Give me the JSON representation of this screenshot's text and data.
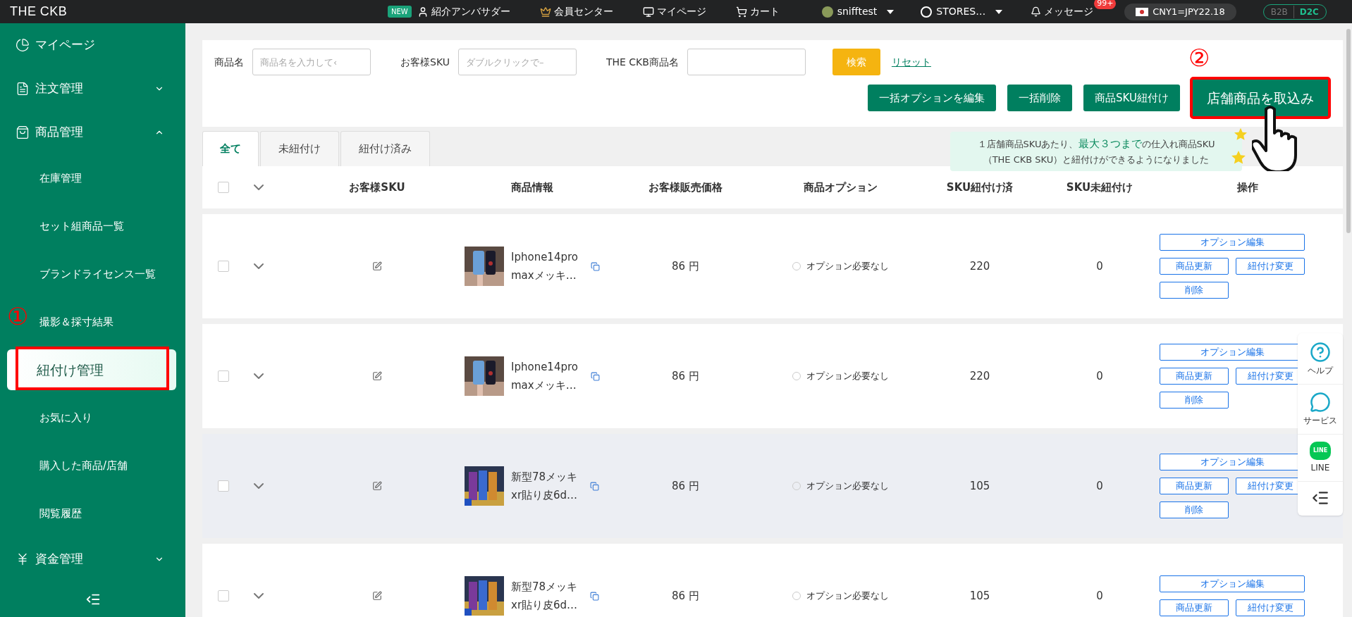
{
  "topbar": {
    "logo": "THE CKB",
    "nav": [
      {
        "kind": "ambassador",
        "badge": "NEW",
        "label": "紹介アンバサダー"
      },
      {
        "kind": "member",
        "label": "会員センター"
      },
      {
        "kind": "mypage",
        "label": "マイページ"
      },
      {
        "kind": "cart",
        "label": "カート"
      }
    ],
    "user": "snifftest",
    "store": "STORES…",
    "messages": {
      "label": "メッセージ",
      "badge": "99+"
    },
    "currency": "CNY1=JPY22.18",
    "modes": [
      {
        "label": "B2B",
        "selected": false
      },
      {
        "label": "D2C",
        "selected": true
      }
    ]
  },
  "sidebar": {
    "items": [
      {
        "kind": "pie",
        "label": "マイページ"
      },
      {
        "kind": "order",
        "label": "注文管理",
        "expanded": false
      },
      {
        "kind": "bag",
        "label": "商品管理",
        "expanded": true,
        "children": [
          {
            "label": "在庫管理",
            "selected": false
          },
          {
            "label": "セット組商品一覧",
            "selected": false
          },
          {
            "label": "ブランドライセンス一覧",
            "selected": false
          },
          {
            "label": "撮影＆採寸結果",
            "selected": false
          },
          {
            "label": "紐付け管理",
            "selected": true
          },
          {
            "label": "お気に入り",
            "selected": false
          },
          {
            "label": "購入した商品/店舗",
            "selected": false
          },
          {
            "label": "閲覧履歴",
            "selected": false
          }
        ]
      },
      {
        "kind": "yen",
        "label": "資金管理",
        "expanded": false
      }
    ]
  },
  "markers": [
    "①",
    "②"
  ],
  "filters": {
    "fields": [
      {
        "label": "商品名",
        "placeholder": "商品名を入力して‹"
      },
      {
        "label": "お客様SKU",
        "placeholder": "ダブルクリックで–"
      },
      {
        "label": "THE CKB商品名"
      }
    ],
    "search": "検索",
    "reset": "リセット"
  },
  "actions": [
    {
      "label": "一括オプションを編集",
      "highlighted": false
    },
    {
      "label": "一括削除",
      "highlighted": false
    },
    {
      "label": "商品SKU紐付け",
      "highlighted": false
    },
    {
      "label": "店舗商品を取込み",
      "highlighted": true
    }
  ],
  "tooltip": {
    "line1": "１店舗商品SKUあたり、**最大３つまで**の仕入れ商品SKU",
    "line2": "（THE CKB SKU）と紐付けができるようになりました"
  },
  "tabs": [
    {
      "label": "全て",
      "selected": true
    },
    {
      "label": "未紐付け",
      "selected": false
    },
    {
      "label": "紐付け済み",
      "selected": false
    }
  ],
  "table": {
    "select_all": {
      "checked": false
    },
    "columns": [
      "お客様SKU",
      "商品情報",
      "お客様販売価格",
      "商品オプション",
      "SKU紐付け済",
      "SKU未紐付け",
      "操作"
    ],
    "rows": [
      {
        "name": [
          "Iphone14pro",
          "maxメッキ…"
        ],
        "price": "86 円",
        "option": "オプション必要なし",
        "linked": "220",
        "unlinked": "0",
        "hovered": false,
        "actions": [
          "オプション編集",
          "商品更新",
          "紐付け変更",
          "削除"
        ]
      },
      {
        "name": [
          "Iphone14pro",
          "maxメッキ…"
        ],
        "price": "86 円",
        "option": "オプション必要なし",
        "linked": "220",
        "unlinked": "0",
        "hovered": false,
        "actions": [
          "オプション編集",
          "商品更新",
          "紐付け変更",
          "削除"
        ]
      },
      {
        "name": [
          "新型78メッキ",
          "xr貼り皮6d…"
        ],
        "price": "86 円",
        "option": "オプション必要なし",
        "linked": "105",
        "unlinked": "0",
        "hovered": true,
        "actions": [
          "オプション編集",
          "商品更新",
          "紐付け変更",
          "削除"
        ]
      },
      {
        "name": [
          "新型78メッキ",
          "xr貼り皮6d…"
        ],
        "price": "86 円",
        "option": "オプション必要なし",
        "linked": "105",
        "unlinked": "0",
        "hovered": false,
        "actions": [
          "オプション編集",
          "商品更新",
          "紐付け変更"
        ]
      }
    ]
  },
  "float_panel": [
    {
      "kind": "help",
      "label": "ヘルプ"
    },
    {
      "kind": "service",
      "label": "サービス"
    },
    {
      "kind": "line",
      "icon_text": "LINE",
      "label": "LINE"
    },
    {
      "kind": "indent"
    }
  ]
}
